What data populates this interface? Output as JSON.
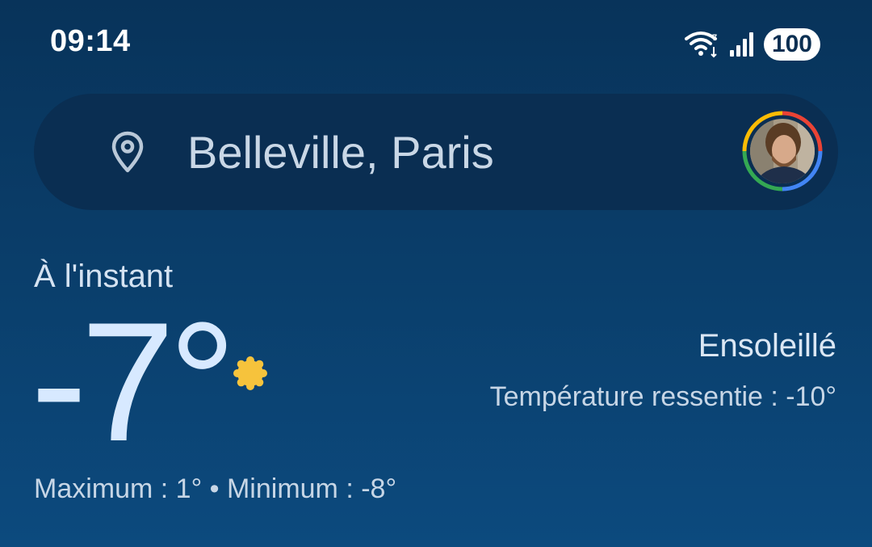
{
  "status_bar": {
    "time": "09:14",
    "battery": "100",
    "icons": [
      "wifi-icon",
      "signal-icon",
      "battery-icon"
    ]
  },
  "location_bar": {
    "pin_icon": "location-pin-icon",
    "location": "Belleville, Paris",
    "avatar": "account-avatar"
  },
  "weather": {
    "now_label": "À l'instant",
    "temperature": "-7°",
    "condition_icon": "sun-icon",
    "condition": "Ensoleillé",
    "feels_like": "Température ressentie : -10°",
    "max_min": "Maximum : 1° • Minimum : -8°"
  },
  "colors": {
    "background_top": "#08335a",
    "background_bottom": "#0c4a7e",
    "search_bar": "#0a2e52",
    "temperature": "#d7e9ff",
    "sun": "#f6c33c"
  }
}
